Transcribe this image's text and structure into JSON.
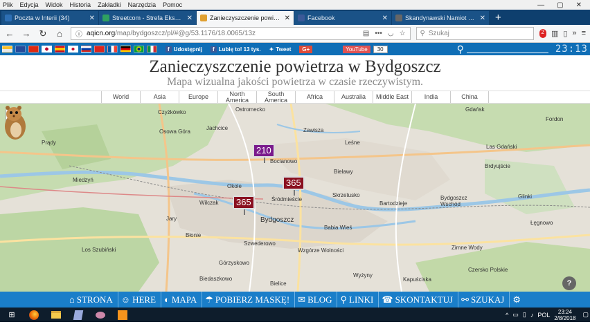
{
  "menu": {
    "items": [
      "Plik",
      "Edycja",
      "Widok",
      "Historia",
      "Zakładki",
      "Narzędzia",
      "Pomoc"
    ]
  },
  "tabs": [
    {
      "title": "Poczta w Interii (34)",
      "color": "#2d6fb4",
      "active": false
    },
    {
      "title": "Streetcom - Strefa Eksperta",
      "color": "#2fa060",
      "active": false
    },
    {
      "title": "Zanieczyszczenie powietrza w B",
      "color": "#e0a030",
      "active": true
    },
    {
      "title": "Facebook",
      "color": "#3b5998",
      "active": false
    },
    {
      "title": "Skandynawski Namiot Tipi - A",
      "color": "#666666",
      "active": false
    }
  ],
  "address": {
    "domain": "aqicn.org",
    "path": "/map/bydgoszcz/pl/#@g/53.1176/18.0065/13z"
  },
  "search": {
    "placeholder": "Szukaj"
  },
  "toolbar": {
    "ext_badge": "2"
  },
  "social": {
    "share": "Udostępnij",
    "like": "Lubię to! 13 tys.",
    "tweet": "Tweet",
    "gplus": "G+",
    "youtube": "YouTube",
    "count": "30"
  },
  "clock": "23:13",
  "header": {
    "title": "Zanieczyszczenie powietrza w Bydgoszcz",
    "subtitle": "Mapa wizualna jakości powietrza w czasie rzeczywistym."
  },
  "regions": [
    "World",
    "Asia",
    "Europe",
    "North America",
    "South America",
    "Africa",
    "Australia",
    "Middle East",
    "India",
    "China"
  ],
  "zoom": {
    "in": "+",
    "out": "−"
  },
  "markers": [
    {
      "value": "210",
      "color": "#7a1a8c"
    },
    {
      "value": "365",
      "color": "#8a1020"
    },
    {
      "value": "365",
      "color": "#8a1020"
    }
  ],
  "map_labels": [
    "Czyżkówko",
    "Jachcice",
    "Prądy",
    "Osowa Góra",
    "Miedzyń",
    "Okole",
    "Wilczak",
    "Jary",
    "Błonie",
    "Los Szubiński",
    "Śródmieście",
    "Bydgoszcz",
    "Bocianowo",
    "Zawisza",
    "Leśne",
    "Bielawy",
    "Bartodzieje",
    "Skrzetusko",
    "Bydgoszcz Wschód",
    "Fordon",
    "Glinki",
    "Bielice",
    "Łęgnowo",
    "Kapuściska",
    "Zimne Wody",
    "Czersko Polskie",
    "Szwederowo",
    "Wzgórze Wolności",
    "Górzyskowo",
    "Biedaszkowo",
    "Wyżyny",
    "Babia Wieś",
    "Las Gdański",
    "Brdyujście",
    "Ostromecko",
    "Gdańsk"
  ],
  "bottom_nav": [
    {
      "label": "STRONA",
      "icon": "home-icon",
      "glyph": "⌂"
    },
    {
      "label": "HERE",
      "icon": "person-icon",
      "glyph": "☺"
    },
    {
      "label": "MAPA",
      "icon": "globe-icon",
      "glyph": "◐"
    },
    {
      "label": "POBIERZ MASKĘ!",
      "icon": "mask-icon",
      "glyph": "☂"
    },
    {
      "label": "BLOG",
      "icon": "chat-icon",
      "glyph": "✉"
    },
    {
      "label": "LINKI",
      "icon": "link-search-icon",
      "glyph": "⚲"
    },
    {
      "label": "SKONTAKTUJ",
      "icon": "contact-icon",
      "glyph": "☎"
    },
    {
      "label": "SZUKAJ",
      "icon": "link-icon",
      "glyph": "⚯"
    },
    {
      "label": "",
      "icon": "settings-icon",
      "glyph": "⚙"
    }
  ],
  "taskbar": {
    "lang": "POL",
    "time": "23:24",
    "date": "2/8/2018"
  }
}
